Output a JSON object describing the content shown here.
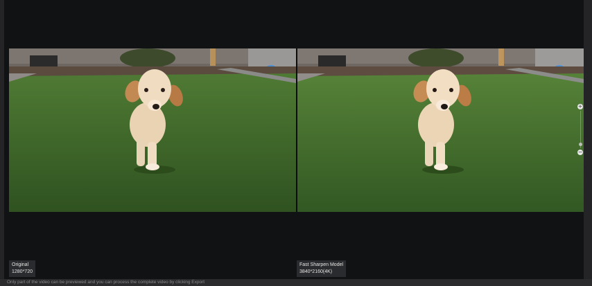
{
  "panes": {
    "left": {
      "title": "Original",
      "resolution": "1280*720"
    },
    "right": {
      "title": "Fast Sharpen Model",
      "resolution": "3840*2160(4K)"
    }
  },
  "zoom": {
    "zoom_in_icon": "plus-circle-icon",
    "zoom_out_icon": "minus-circle-icon",
    "level": 0.9
  },
  "status_text": "Only part of the video can be previewed and you can process the complete video by clicking Export",
  "colors": {
    "background": "#111214",
    "label_bg": "#2a2b2e",
    "grass": "#3f6b2a"
  }
}
